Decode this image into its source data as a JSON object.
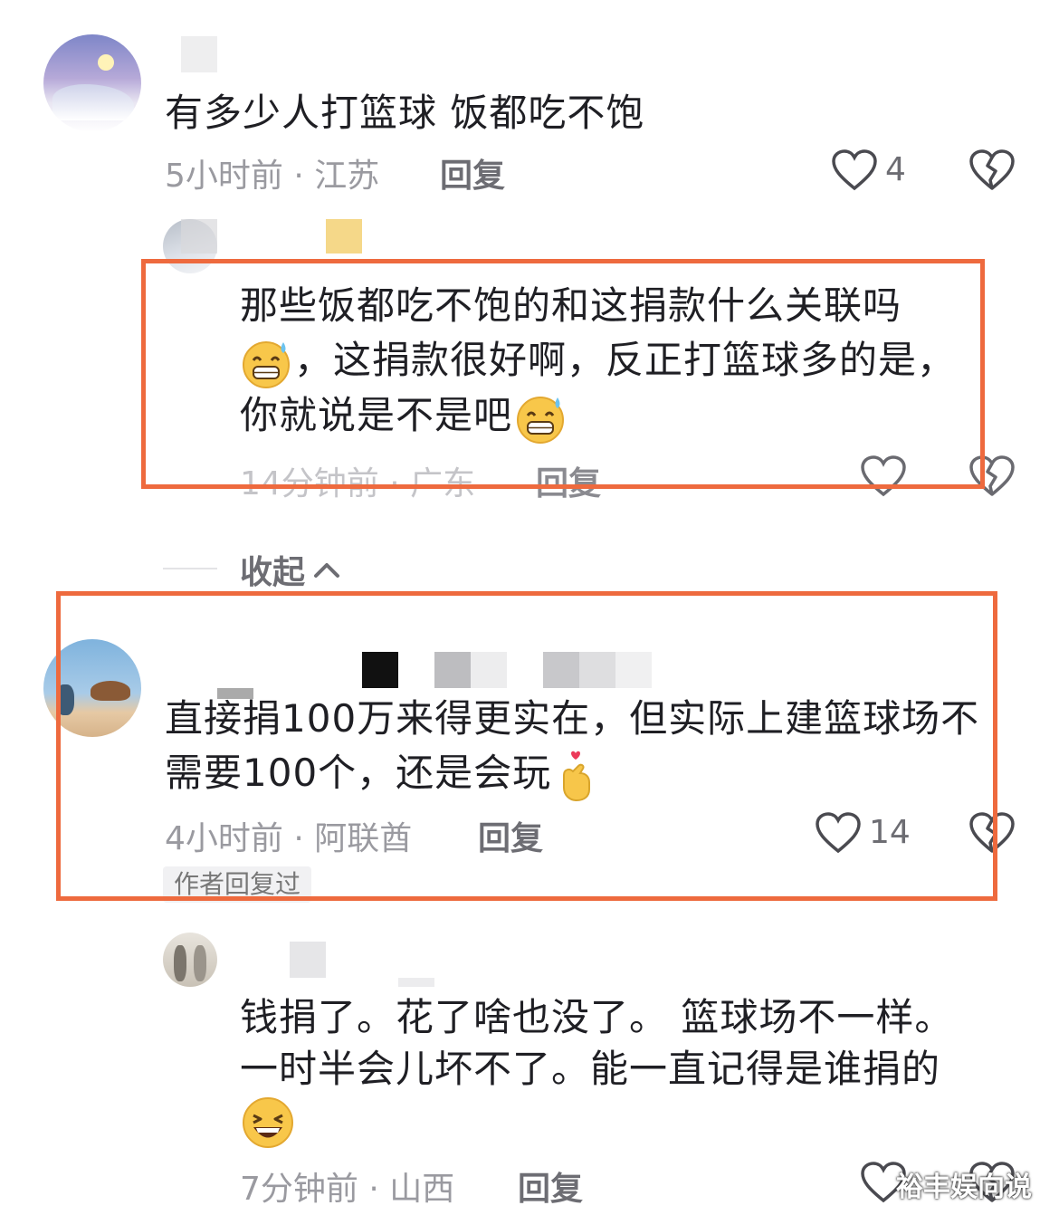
{
  "comments": [
    {
      "text": "有多少人打篮球 饭都吃不饱",
      "meta": "5小时前 · 江苏",
      "reply_label": "回复",
      "likes": "4"
    },
    {
      "text_line1": "那些饭都吃不饱的和这捐款什么关联吗",
      "text_line2": "，这捐款很好啊，反正打篮球多的是，",
      "text_line3": "你就说是不是吧",
      "meta": "14分钟前 · 广东",
      "reply_label": "回复"
    },
    {
      "collapse_label": "收起"
    },
    {
      "text_line1": "直接捐100万来得更实在，但实际上建篮球场不",
      "text_line2": "需要100个，还是会玩",
      "meta": "4小时前 · 阿联酋",
      "reply_label": "回复",
      "likes": "14",
      "badge": "作者回复过"
    },
    {
      "text_line1": "钱捐了。花了啥也没了。 篮球场不一样。",
      "text_line2": "一时半会儿坏不了。能一直记得是谁捐的",
      "meta": "7分钟前 · 山西",
      "reply_label": "回复"
    }
  ],
  "watermark": "裕丰娱向说",
  "colors": {
    "highlight": "#ee6a3e",
    "meta": "#9a9aa0"
  },
  "icons": [
    "heart-icon",
    "dislike-icon",
    "chevron-up-icon",
    "grin-sweat-emoji",
    "finger-heart-emoji",
    "laugh-emoji"
  ]
}
